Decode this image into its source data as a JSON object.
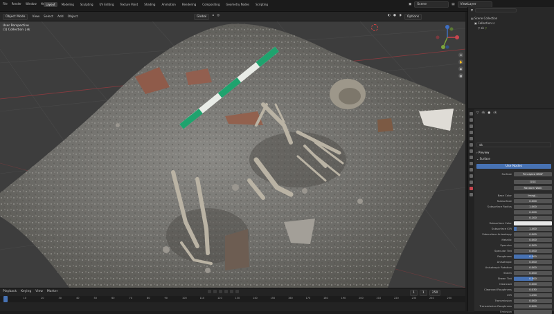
{
  "menu": [
    "File",
    "Render",
    "Window",
    "Help"
  ],
  "workspaces": [
    "Layout",
    "Modeling",
    "Sculpting",
    "UV Editing",
    "Texture Paint",
    "Shading",
    "Animation",
    "Rendering",
    "Compositing",
    "Geometry Nodes",
    "Scripting"
  ],
  "active_workspace": "Layout",
  "scene": "Scene",
  "view_layer": "ViewLayer",
  "viewport_header": {
    "mode": "Object Mode",
    "menus": [
      "View",
      "Select",
      "Add",
      "Object"
    ],
    "transform": "Global",
    "options": "Options"
  },
  "transform_bar": {
    "orientation": "Default",
    "drag": "Drag",
    "select": "Select Box"
  },
  "viewport_info": {
    "line1": "User Perspective",
    "line2": "(1) Collection | sk"
  },
  "timeline": {
    "menus": [
      "Playback",
      "Keying",
      "View",
      "Marker"
    ],
    "current_frame": "1",
    "start": "1",
    "end": "250",
    "ruler": [
      "0",
      "10",
      "20",
      "30",
      "40",
      "50",
      "60",
      "70",
      "80",
      "90",
      "100",
      "110",
      "120",
      "130",
      "140",
      "150",
      "160",
      "170",
      "180",
      "190",
      "200",
      "210",
      "220",
      "230",
      "240",
      "250"
    ]
  },
  "outliner": {
    "root": "Scene Collection",
    "collection": "Collection",
    "object": "sk"
  },
  "properties": {
    "object": "sk",
    "material": "sk",
    "material_btn": "Use Nodes",
    "sections": [
      "Preview",
      "Surface"
    ],
    "surface_label": "Surface",
    "surface_value": "Principled BSDF",
    "base_values": [
      "GGX",
      "Random Walk"
    ],
    "rows": [
      {
        "label": "Base Color",
        "value": "ImagJ..."
      },
      {
        "label": "Subsurface",
        "value": "0.000"
      },
      {
        "label": "Subsurface Radius",
        "value": "1.000"
      },
      {
        "label": "",
        "value": "0.200"
      },
      {
        "label": "",
        "value": "0.100"
      },
      {
        "label": "Subsurface Color",
        "value": ""
      },
      {
        "label": "Subsurface IOR",
        "value": "1.400"
      },
      {
        "label": "Subsurface Anisotropy",
        "value": "0.000"
      },
      {
        "label": "Metallic",
        "value": "0.000"
      },
      {
        "label": "Specular",
        "value": "0.500"
      },
      {
        "label": "Specular Tint",
        "value": "0.000"
      },
      {
        "label": "Roughness",
        "value": "0.500"
      },
      {
        "label": "Anisotropic",
        "value": "0.000"
      },
      {
        "label": "Anisotropic Rotation",
        "value": "0.000"
      },
      {
        "label": "Sheen",
        "value": "0.000"
      },
      {
        "label": "Sheen Tint",
        "value": "0.500"
      },
      {
        "label": "Clearcoat",
        "value": "0.000"
      },
      {
        "label": "Clearcoat Roughness",
        "value": "0.030"
      },
      {
        "label": "IOR",
        "value": "1.450"
      },
      {
        "label": "Transmission",
        "value": "0.000"
      },
      {
        "label": "Transmission Roughness",
        "value": "0.000"
      },
      {
        "label": "Emission",
        "value": ""
      }
    ]
  },
  "colors": {
    "accent": "#4772b3",
    "x_axis": "#c9454f",
    "y_axis": "#7ba33c",
    "z_axis": "#3f6fc2"
  }
}
